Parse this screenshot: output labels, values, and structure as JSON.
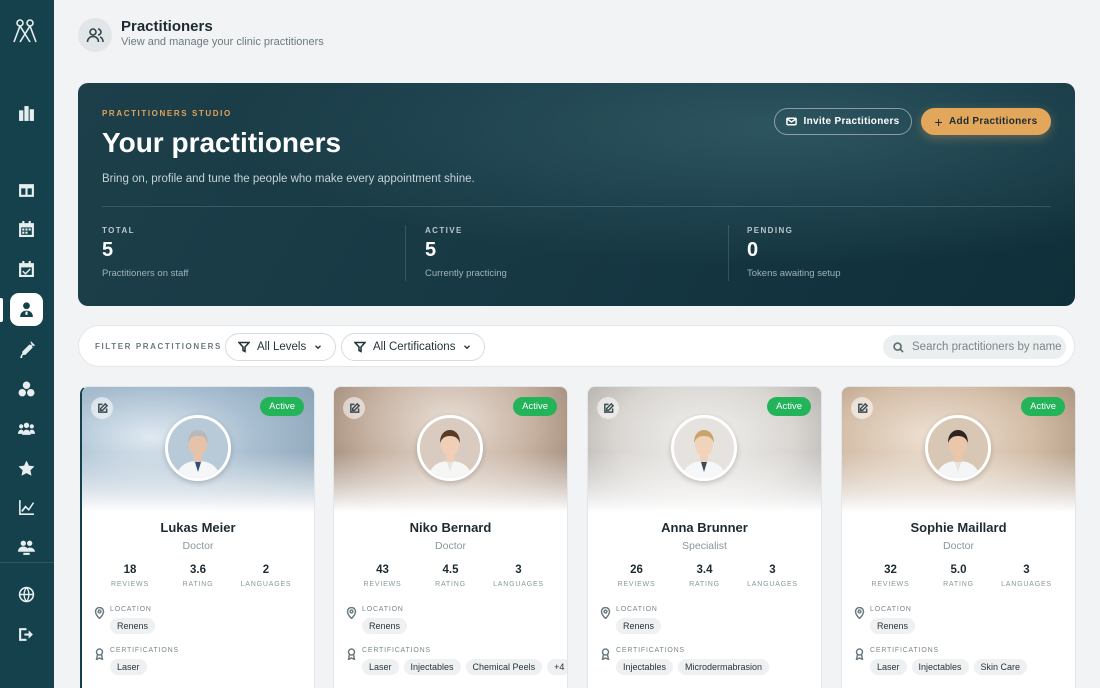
{
  "header": {
    "title": "Practitioners",
    "subtitle": "View and manage your clinic practitioners"
  },
  "hero": {
    "eyebrow": "PRACTITIONERS STUDIO",
    "title": "Your practitioners",
    "description": "Bring on, profile and tune the people who make every appointment shine.",
    "invite_label": "Invite Practitioners",
    "add_label": "Add Practitioners",
    "stats": [
      {
        "label": "TOTAL",
        "value": "5",
        "sub": "Practitioners on staff"
      },
      {
        "label": "ACTIVE",
        "value": "5",
        "sub": "Currently practicing"
      },
      {
        "label": "PENDING",
        "value": "0",
        "sub": "Tokens awaiting setup"
      }
    ]
  },
  "filters": {
    "label": "FILTER PRACTITIONERS",
    "levels": "All Levels",
    "certifications": "All Certifications",
    "search_placeholder": "Search practitioners by name"
  },
  "card_labels": {
    "reviews": "REVIEWS",
    "rating": "RATING",
    "languages": "LANGUAGES",
    "location": "LOCATION",
    "certifications": "CERTIFICATIONS"
  },
  "practitioners": [
    {
      "name": "Lukas Meier",
      "role": "Doctor",
      "status": "Active",
      "reviews": "18",
      "rating": "3.6",
      "languages": "2",
      "location": "Renens",
      "certifications": [
        "Laser"
      ]
    },
    {
      "name": "Niko Bernard",
      "role": "Doctor",
      "status": "Active",
      "reviews": "43",
      "rating": "4.5",
      "languages": "3",
      "location": "Renens",
      "certifications": [
        "Laser",
        "Injectables",
        "Chemical Peels",
        "+4"
      ]
    },
    {
      "name": "Anna Brunner",
      "role": "Specialist",
      "status": "Active",
      "reviews": "26",
      "rating": "3.4",
      "languages": "3",
      "location": "Renens",
      "certifications": [
        "Injectables",
        "Microdermabrasion"
      ]
    },
    {
      "name": "Sophie Maillard",
      "role": "Doctor",
      "status": "Active",
      "reviews": "32",
      "rating": "5.0",
      "languages": "3",
      "location": "Renens",
      "certifications": [
        "Laser",
        "Injectables",
        "Skin Care"
      ]
    }
  ],
  "colors": {
    "sidebar": "#14414c",
    "accent": "#e2a75b",
    "active_status": "#23b45a"
  },
  "sidebar_icons": [
    "logo-icon",
    "buildings-icon",
    "layout-icon",
    "calendar-icon",
    "calendar-check-icon",
    "practitioner-icon",
    "syringe-icon",
    "products-icon",
    "clients-icon",
    "star-icon",
    "chart-icon",
    "team-icon",
    "globe-icon",
    "logout-icon"
  ]
}
